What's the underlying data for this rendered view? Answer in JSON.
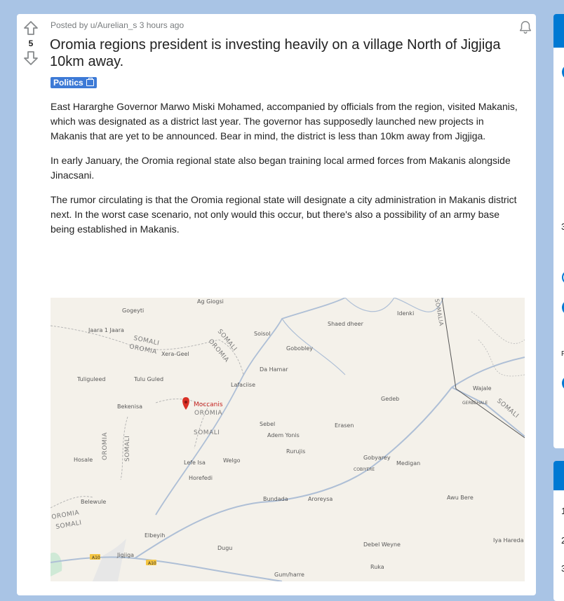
{
  "post": {
    "score": "5",
    "meta": "Posted by u/Aurelian_s 3 hours ago",
    "title": "Oromia regions president is investing heavily on a village North of Jigjiga 10km away.",
    "flair": "Politics",
    "paragraphs": [
      "East Hararghe Governor Marwo Miski Mohamed, accompanied by officials from the region, visited Makanis, which was designated as a district last year. The governor has supposedly launched new projects in Makanis that are yet to be announced. Bear in mind, the district is less than 10km away from Jigjiga.",
      "In early January, the Oromia regional state also began training local armed forces from Makanis alongside Jinacsani.",
      "The rumor circulating is that the Oromia regional state will designate a city administration in Makanis district next. In the worst case scenario, not only would this occur, but there's also a possibility of an army base being established in Makanis."
    ]
  },
  "map": {
    "places": [
      "Gogeyti",
      "Ag Giogsi",
      "Idenki",
      "Shaed dheer",
      "Jaara 1 Jaara",
      "Soisol",
      "Gobobley",
      "Xera-Geel",
      "Da Hamar",
      "Tuliguleed",
      "Tulu Guled",
      "Lafaciise",
      "Wajale",
      "Bekenisa",
      "Moccanis",
      "Gedeb",
      "Sebel",
      "Adem Yonis",
      "Erasen",
      "Rurujis",
      "Hosale",
      "Lefe Isa",
      "Welgo",
      "Gobyarey",
      "Medigan",
      "Horefedi",
      "Bundada",
      "Aroreysa",
      "Awu Bere",
      "Belewule",
      "Elbeyih",
      "Dugu",
      "Debel Weyne",
      "Iya Hareda Ali Beyle",
      "Jigjiga",
      "Ruka",
      "Gum/harre",
      "GERBEHALE",
      "COBIYERE"
    ],
    "regions": [
      "SOMALI",
      "OROMIA",
      "SOMALIA"
    ],
    "roads": [
      "A10",
      "A10"
    ]
  },
  "sidebar": {
    "items": [
      "1",
      "2",
      "3",
      "3",
      "F"
    ]
  },
  "colors": {
    "page_bg": "#a9c4e5",
    "flair": "#3d7ad6",
    "accent": "#0079d3",
    "marker": "#d93025"
  },
  "icons": [
    "upvote-icon",
    "downvote-icon",
    "bell-icon",
    "tv-icon",
    "map-marker-icon"
  ]
}
